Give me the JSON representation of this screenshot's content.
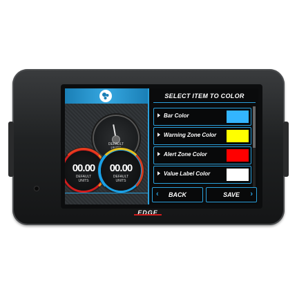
{
  "brand": {
    "logo_text": "EDGE"
  },
  "screen": {
    "left_panel": {
      "tab_icon": "gauge-layout-icon",
      "gauges": [
        {
          "name": "top-gauge",
          "units": "DEFAULT\nUNITS"
        },
        {
          "name": "red-gauge",
          "value": "00.00",
          "units": "DEFAULT\nUNITS"
        },
        {
          "name": "blue-gauge",
          "value": "00.00",
          "units": "DEFAULT\nUNITS"
        }
      ]
    },
    "right_panel": {
      "title": "SELECT ITEM TO COLOR",
      "items": [
        {
          "label": "Bar Color",
          "color": "#33b5ff"
        },
        {
          "label": "Warning Zone Color",
          "color": "#ffff00"
        },
        {
          "label": "Alert Zone Color",
          "color": "#ff0000"
        },
        {
          "label": "Value Label Color",
          "color": "#ffffff"
        }
      ],
      "back_label": "BACK",
      "save_label": "SAVE"
    }
  },
  "colors": {
    "accent": "#2aa0dc",
    "red_gauge": "#d21c1c",
    "blue_gauge": "#1aa0e6"
  }
}
